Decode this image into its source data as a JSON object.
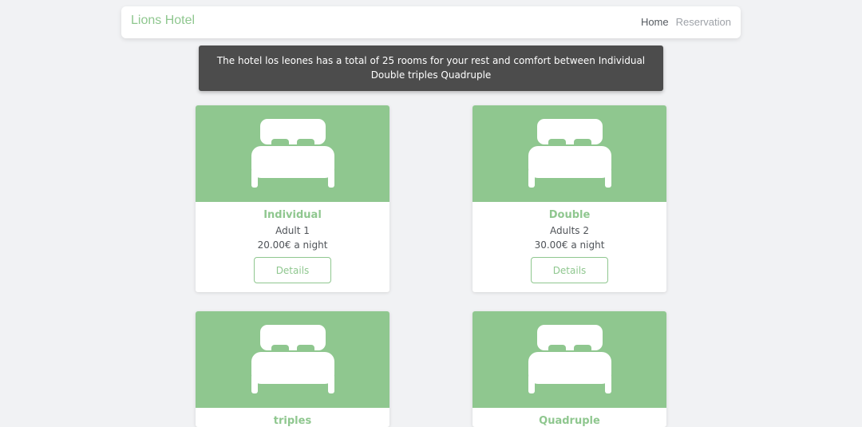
{
  "navbar": {
    "brand": "Lions Hotel",
    "links": [
      {
        "label": "Home"
      },
      {
        "label": "Reservation"
      }
    ]
  },
  "banner": {
    "text": "The hotel los leones has a total of 25 rooms for your rest and comfort between Individual Double triples Quadruple"
  },
  "rooms": [
    {
      "name": "Individual",
      "adults": "Adult 1",
      "price": "20.00€ a night",
      "button": "Details"
    },
    {
      "name": "Double",
      "adults": "Adults 2",
      "price": "30.00€ a night",
      "button": "Details"
    },
    {
      "name": "triples"
    },
    {
      "name": "Quadruple"
    }
  ],
  "colors": {
    "accent": "#8fc78f",
    "banner_bg": "#4c4c4c",
    "page_bg": "#f1f2f4"
  },
  "icons": {
    "room_image": "bed-icon"
  }
}
